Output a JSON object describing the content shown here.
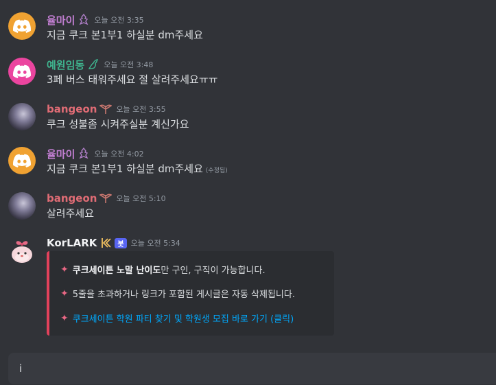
{
  "colors": {
    "background": "#313338",
    "name_purple": "#c27fd2",
    "name_teal": "#3fb58f",
    "name_red": "#e06c75",
    "bot_name": "#f2f3f5",
    "embed_accent": "#e2415b",
    "link": "#00a8fc"
  },
  "messages": [
    {
      "username": "율마이",
      "timestamp": "오늘 오전 3:35",
      "text": "지금 쿠크 본1부1 하실분 dm주세요",
      "avatar": "discord-logo-orange",
      "role_icon": "crest-icon"
    },
    {
      "username": "예원임동",
      "timestamp": "오늘 오전 3:48",
      "text": "3페 버스 태워주세요 절 살려주세요ㅠㅠ",
      "avatar": "discord-logo-pink",
      "role_icon": "dragon-icon"
    },
    {
      "username": "bangeon",
      "timestamp": "오늘 오전 3:55",
      "text": "쿠크 성불좀 시켜주실분 계신가요",
      "avatar": "photo",
      "role_icon": "wings-icon"
    },
    {
      "username": "율마이",
      "timestamp": "오늘 오전 4:02",
      "text": "지금 쿠크 본1부1 하실분 dm주세요",
      "edited": "(수정됨)",
      "avatar": "discord-logo-orange",
      "role_icon": "crest-icon"
    },
    {
      "username": "bangeon",
      "timestamp": "오늘 오전 5:10",
      "text": "살려주세요",
      "avatar": "photo",
      "role_icon": "wings-icon"
    }
  ],
  "bot_message": {
    "username": "KorLARK",
    "bot_tag": "봇",
    "timestamp": "오늘 오전 5:34",
    "embed": {
      "line1_bold": "쿠크세이튼 노말 난이도",
      "line1_rest": "만 구인, 구직이 가능합니다.",
      "line2": "5줄을 초과하거나 링크가 포함된 게시글은 자동 삭제됩니다.",
      "line3_link": "쿠크세이튼 학원 파티 찾기 및 학원생 모집 바로 가기 (클릭)"
    }
  },
  "composer": {
    "value": "i"
  }
}
